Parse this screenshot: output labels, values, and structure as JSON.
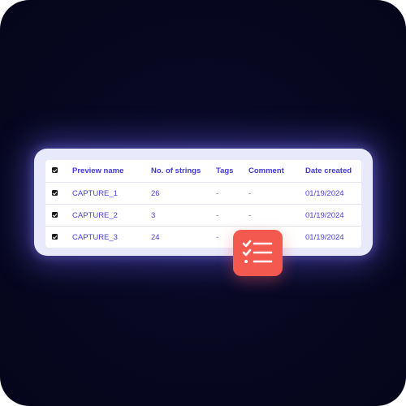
{
  "table": {
    "headers": {
      "preview_name": "Preview name",
      "strings": "No. of strings",
      "tags": "Tags",
      "comment": "Comment",
      "date": "Date created"
    },
    "rows": [
      {
        "name": "CAPTURE_1",
        "strings": "26",
        "tags": "-",
        "comment": "-",
        "date": "01/19/2024",
        "checked": true
      },
      {
        "name": "CAPTURE_2",
        "strings": "3",
        "tags": "-",
        "comment": "-",
        "date": "01/19/2024",
        "checked": true
      },
      {
        "name": "CAPTURE_3",
        "strings": "24",
        "tags": "-",
        "comment": "",
        "date": "01/19/2024",
        "checked": true
      }
    ]
  },
  "badge": {
    "icon": "checklist-icon",
    "color": "#f4594f"
  },
  "colors": {
    "background": "#070720",
    "text_accent": "#4338d8",
    "card_glow": "#6e69ff"
  }
}
